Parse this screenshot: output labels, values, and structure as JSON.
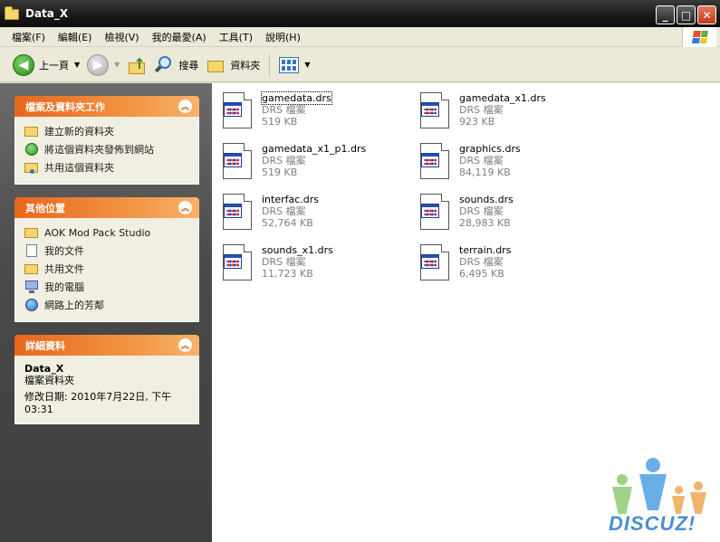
{
  "window": {
    "title": "Data_X"
  },
  "menu": [
    "檔案(F)",
    "編輯(E)",
    "檢視(V)",
    "我的最愛(A)",
    "工具(T)",
    "說明(H)"
  ],
  "toolbar": {
    "back_label": "上一頁",
    "search_label": "搜尋",
    "folders_label": "資料夾"
  },
  "tasks_panel": {
    "title": "檔案及資料夾工作",
    "items": [
      "建立新的資料夾",
      "將這個資料夾發佈到網站",
      "共用這個資料夾"
    ]
  },
  "places_panel": {
    "title": "其他位置",
    "items": [
      "AOK Mod Pack Studio",
      "我的文件",
      "共用文件",
      "我的電腦",
      "網路上的芳鄰"
    ]
  },
  "details_panel": {
    "title": "詳細資料",
    "name": "Data_X",
    "type": "檔案資料夾",
    "modified_line1": "修改日期: 2010年7月22日, 下午",
    "modified_line2": "03:31"
  },
  "files": [
    {
      "name": "gamedata.drs",
      "type": "DRS 檔案",
      "size": "519 KB"
    },
    {
      "name": "gamedata_x1.drs",
      "type": "DRS 檔案",
      "size": "923 KB"
    },
    {
      "name": "gamedata_x1_p1.drs",
      "type": "DRS 檔案",
      "size": "519 KB"
    },
    {
      "name": "graphics.drs",
      "type": "DRS 檔案",
      "size": "84,119 KB"
    },
    {
      "name": "interfac.drs",
      "type": "DRS 檔案",
      "size": "52,764 KB"
    },
    {
      "name": "sounds.drs",
      "type": "DRS 檔案",
      "size": "28,983 KB"
    },
    {
      "name": "sounds_x1.drs",
      "type": "DRS 檔案",
      "size": "11,723 KB"
    },
    {
      "name": "terrain.drs",
      "type": "DRS 檔案",
      "size": "6,495 KB"
    }
  ],
  "watermark": {
    "text": "DISCUZ!"
  }
}
